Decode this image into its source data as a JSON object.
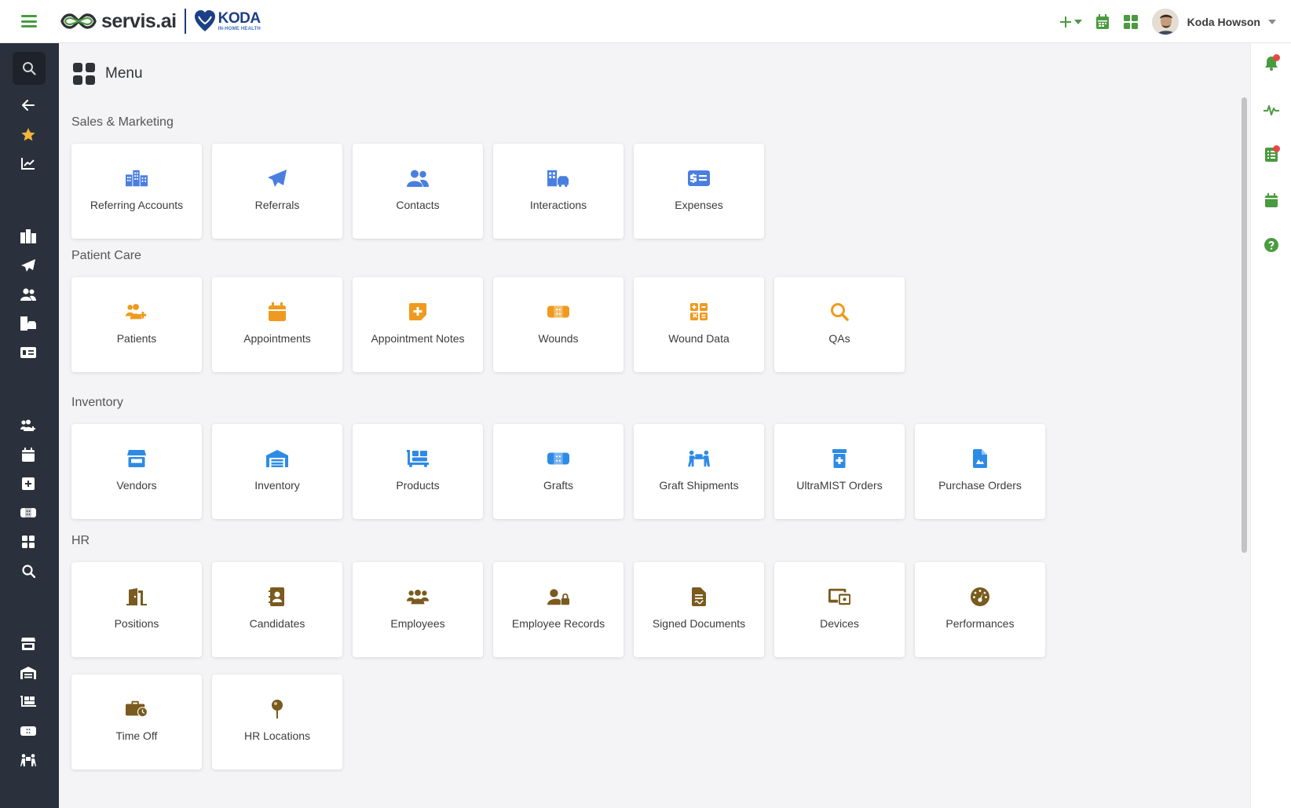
{
  "header": {
    "brand": "servis.ai",
    "partner_name": "KODA",
    "partner_tagline": "IN-HOME HEALTH",
    "user_name": "Koda Howson"
  },
  "colors": {
    "accent_green": "#4a9b3f",
    "sidebar_bg": "#2a313c",
    "sales_icon": "#4a7fe0",
    "patient_icon": "#ef9a1e",
    "inventory_icon": "#2d8be6",
    "hr_icon": "#7a5a1e"
  },
  "page": {
    "title": "Menu"
  },
  "sections": [
    {
      "title": "Sales & Marketing",
      "items": [
        {
          "label": "Referring Accounts",
          "icon": "buildings-icon"
        },
        {
          "label": "Referrals",
          "icon": "paper-plane-icon"
        },
        {
          "label": "Contacts",
          "icon": "users-icon"
        },
        {
          "label": "Interactions",
          "icon": "building-car-icon"
        },
        {
          "label": "Expenses",
          "icon": "money-card-icon"
        }
      ]
    },
    {
      "title": "Patient Care",
      "items": [
        {
          "label": "Patients",
          "icon": "patients-icon"
        },
        {
          "label": "Appointments",
          "icon": "calendar-icon"
        },
        {
          "label": "Appointment Notes",
          "icon": "note-plus-icon"
        },
        {
          "label": "Wounds",
          "icon": "bandage-icon"
        },
        {
          "label": "Wound Data",
          "icon": "calculator-icon"
        },
        {
          "label": "QAs",
          "icon": "magnifier-icon"
        }
      ]
    },
    {
      "title": "Inventory",
      "items": [
        {
          "label": "Vendors",
          "icon": "store-icon"
        },
        {
          "label": "Inventory",
          "icon": "warehouse-icon"
        },
        {
          "label": "Products",
          "icon": "dolly-icon"
        },
        {
          "label": "Grafts",
          "icon": "bandage-icon"
        },
        {
          "label": "Graft Shipments",
          "icon": "people-carry-icon"
        },
        {
          "label": "UltraMIST Orders",
          "icon": "prescription-bottle-icon"
        },
        {
          "label": "Purchase Orders",
          "icon": "file-invoice-icon"
        }
      ]
    },
    {
      "title": "HR",
      "items": [
        {
          "label": "Positions",
          "icon": "door-open-icon"
        },
        {
          "label": "Candidates",
          "icon": "address-book-icon"
        },
        {
          "label": "Employees",
          "icon": "users-icon"
        },
        {
          "label": "Employee Records",
          "icon": "user-lock-icon"
        },
        {
          "label": "Signed Documents",
          "icon": "file-signature-icon"
        },
        {
          "label": "Devices",
          "icon": "devices-icon"
        },
        {
          "label": "Performances",
          "icon": "gauge-icon"
        },
        {
          "label": "Time Off",
          "icon": "briefcase-clock-icon"
        },
        {
          "label": "HR Locations",
          "icon": "map-pin-icon"
        }
      ]
    }
  ]
}
